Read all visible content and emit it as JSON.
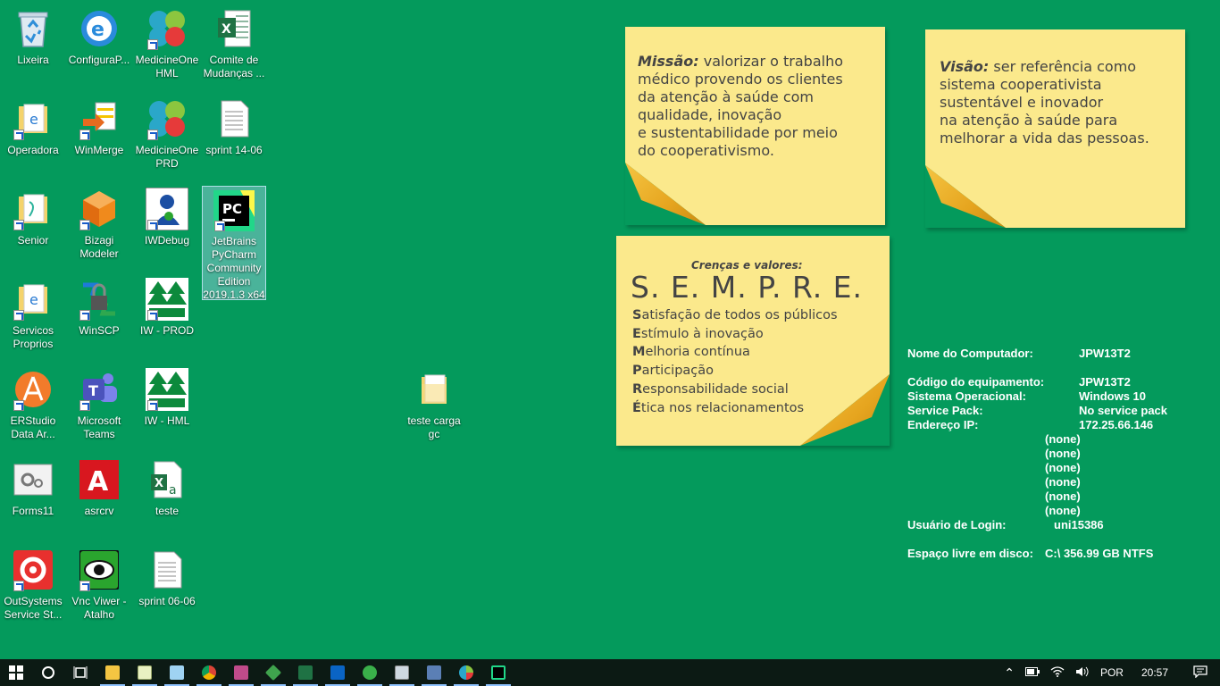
{
  "desktop": {
    "icons": [
      {
        "label": "Lixeira"
      },
      {
        "label": "ConfiguraP..."
      },
      {
        "label": "MedicineOne HML"
      },
      {
        "label": "Comite de Mudanças ..."
      },
      {
        "label": "Operadora"
      },
      {
        "label": "WinMerge"
      },
      {
        "label": "MedicineOne PRD"
      },
      {
        "label": "sprint 14-06"
      },
      {
        "label": "Senior"
      },
      {
        "label": "Bizagi Modeler"
      },
      {
        "label": "IWDebug"
      },
      {
        "label": "JetBrains PyCharm Community Edition 2019.1.3 x64"
      },
      {
        "label": "Servicos Proprios"
      },
      {
        "label": "WinSCP"
      },
      {
        "label": "IW - PROD"
      },
      {
        "label": "ERStudio Data Ar..."
      },
      {
        "label": "Microsoft Teams"
      },
      {
        "label": "IW - HML"
      },
      {
        "label": "teste carga gc"
      },
      {
        "label": "Forms11"
      },
      {
        "label": "asrcrv"
      },
      {
        "label": "teste"
      },
      {
        "label": "OutSystems Service St..."
      },
      {
        "label": "Vnc Viwer - Atalho"
      },
      {
        "label": "sprint 06-06"
      }
    ]
  },
  "notes": {
    "missao_title": "Missão:",
    "missao_text_1": " valorizar o trabalho",
    "missao_text_2": "médico provendo os clientes",
    "missao_text_3": "da atenção à saúde com",
    "missao_text_4": "qualidade, inovação",
    "missao_text_5": "e sustentabilidade por meio",
    "missao_text_6": "do cooperativismo.",
    "visao_title": "Visão:",
    "visao_text_1": " ser referência como",
    "visao_text_2": "sistema cooperativista",
    "visao_text_3": "sustentável e inovador",
    "visao_text_4": "na atenção à saúde para",
    "visao_text_5": "melhorar a vida das pessoas.",
    "crencas_title": "Crenças e valores:",
    "sempre": "S. E. M. P. R. E.",
    "values": [
      {
        "initial": "S",
        "rest": "atisfação de todos os públicos"
      },
      {
        "initial": "E",
        "rest": "stímulo à inovação"
      },
      {
        "initial": "M",
        "rest": "elhoria contínua"
      },
      {
        "initial": "P",
        "rest": "articipação"
      },
      {
        "initial": "R",
        "rest": "esponsabilidade social"
      },
      {
        "initial": "É",
        "rest": "tica nos relacionamentos"
      }
    ]
  },
  "bginfo": {
    "computer_name_label": "Nome do Computador:",
    "computer_name": "JPW13T2",
    "equipment_code_label": "Código do equipamento:",
    "equipment_code": "JPW13T2",
    "os_label": "Sistema Operacional:",
    "os": "Windows 10",
    "service_pack_label": "Service Pack:",
    "service_pack": "No service pack",
    "ip_label": "Endereço IP:",
    "ip": "172.25.66.146",
    "ip_extra": [
      "(none)",
      "(none)",
      "(none)",
      "(none)",
      "(none)",
      "(none)"
    ],
    "login_label": "Usuário de Login:",
    "login": "uni15386",
    "disk_label": "Espaço livre em disco:",
    "disk": "C:\\ 356.99 GB NTFS"
  },
  "taskbar": {
    "language": "POR",
    "time": "20:57"
  }
}
